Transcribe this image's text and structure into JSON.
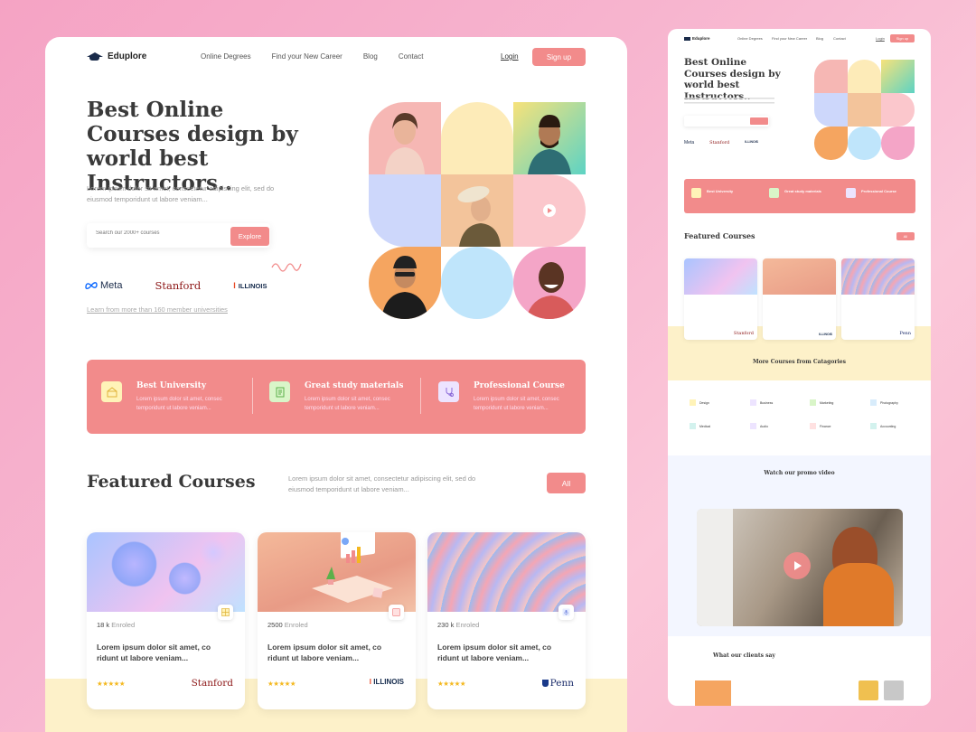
{
  "brand": "Eduplore",
  "nav": {
    "links": [
      "Online Degrees",
      "Find your New Career",
      "Blog",
      "Contact"
    ],
    "login": "Login",
    "signup": "Sign up"
  },
  "hero": {
    "title": "Best Online Courses design by world best Instructors..",
    "subtitle": "Lorem ipsum dolor sit amet, consectetur adipiscing elit, sed do eiusmod temporidunt ut labore veniam...",
    "search_placeholder": "Search our 2000+ courses",
    "explore": "Explore",
    "partners": [
      "Meta",
      "Stanford",
      "ILLINOIS"
    ],
    "learn_more": "Learn from more than 160 member universities"
  },
  "features": [
    {
      "title": "Best University",
      "text": "Lorem ipsum dolor sit amet, consec temporidunt ut labore veniam..."
    },
    {
      "title": "Great study materials",
      "text": "Lorem ipsum dolor sit amet, consec temporidunt ut labore veniam..."
    },
    {
      "title": "Professional Course",
      "text": "Lorem ipsum dolor sit amet, consec temporidunt ut labore veniam..."
    }
  ],
  "featured": {
    "title": "Featured Courses",
    "text": "Lorem ipsum dolor sit amet, consectetur adipiscing elit, sed do eiusmod temporidunt ut labore veniam...",
    "all": "All"
  },
  "courses": [
    {
      "enrolled": "18 k",
      "enrolled_label": "Enroled",
      "title": "Lorem ipsum dolor sit amet, co ridunt ut labore veniam...",
      "stars": "★★★★★",
      "uni": "Stanford"
    },
    {
      "enrolled": "2500",
      "enrolled_label": "Enroled",
      "title": "Lorem ipsum dolor sit amet, co ridunt ut labore veniam...",
      "stars": "★★★★★",
      "uni": "ILLINOIS"
    },
    {
      "enrolled": "230 k",
      "enrolled_label": "Enroled",
      "title": "Lorem ipsum dolor sit amet, co ridunt ut labore veniam...",
      "stars": "★★★★★",
      "uni": "Penn"
    }
  ],
  "side": {
    "categories_title": "More Courses from Catagories",
    "categories": [
      "Design",
      "Business",
      "Marketing",
      "Photography",
      "Medical",
      "Audio",
      "Finance",
      "Accounting"
    ],
    "promo_title": "Watch our promo video",
    "clients_title": "What our clients say"
  },
  "colors": {
    "accent": "#f28b8b",
    "navy": "#1a2b4a",
    "band": "#fdf1c9"
  }
}
